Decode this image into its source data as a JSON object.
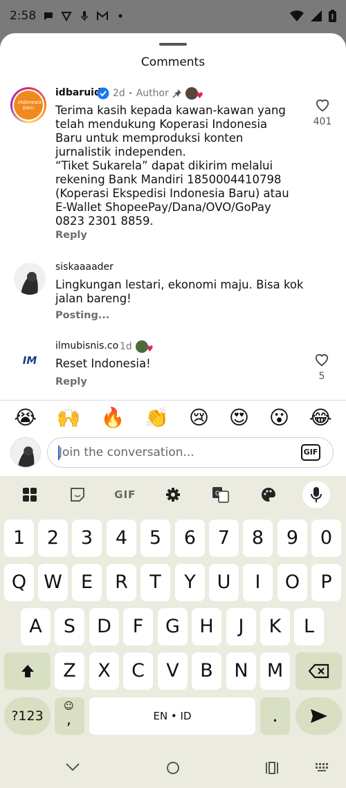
{
  "status_bar": {
    "time": "2:58"
  },
  "sheet": {
    "title": "Comments"
  },
  "comments": [
    {
      "username": "idbaruid",
      "age": "2d",
      "separator": "•",
      "author_label": "Author",
      "text": "Terima kasih kepada kawan-kawan yang telah mendukung Koperasi Indonesia Baru untuk memproduksi konten jurnalistik independen.\n“Tiket Sukarela” dapat dikirim melalui rekening Bank Mandiri 1850004410798 (Koperasi Ekspedisi Indonesia Baru) atau E-Wallet ShopeePay/Dana/OVO/GoPay 0823 2301 8859.",
      "action": "Reply",
      "likes": "401",
      "verified": true,
      "avatar_label": "Indonesia baru"
    },
    {
      "username": "siskaaaader",
      "text": "Lingkungan lestari, ekonomi maju. Bisa kok jalan bareng!",
      "action": "Posting..."
    },
    {
      "username": "ilmubisnis.co",
      "age": "1d",
      "text": "Reset Indonesia!",
      "action": "Reply",
      "likes": "5",
      "avatar_label": "IM"
    }
  ],
  "emoji_bar": [
    "😭",
    "🙌",
    "🔥",
    "👏",
    "😢",
    "😍",
    "😮",
    "😂"
  ],
  "composer": {
    "placeholder": "Join the conversation...",
    "gif_label": "GIF"
  },
  "keyboard": {
    "toolbar_gif": "GIF",
    "row_numbers": [
      "1",
      "2",
      "3",
      "4",
      "5",
      "6",
      "7",
      "8",
      "9",
      "0"
    ],
    "row_q": [
      "Q",
      "W",
      "E",
      "R",
      "T",
      "Y",
      "U",
      "I",
      "O",
      "P"
    ],
    "row_a": [
      "A",
      "S",
      "D",
      "F",
      "G",
      "H",
      "J",
      "K",
      "L"
    ],
    "row_z": [
      "Z",
      "X",
      "C",
      "V",
      "B",
      "N",
      "M"
    ],
    "symbols_key": "?123",
    "emoji_comma_key": ",",
    "space_label": "EN • ID",
    "period_key": "."
  },
  "colors": {
    "accent_green": "#d8dfc3",
    "keyboard_bg": "#ebebdf",
    "verified_blue": "#1a77f2",
    "caret_blue": "#2b62d6"
  }
}
